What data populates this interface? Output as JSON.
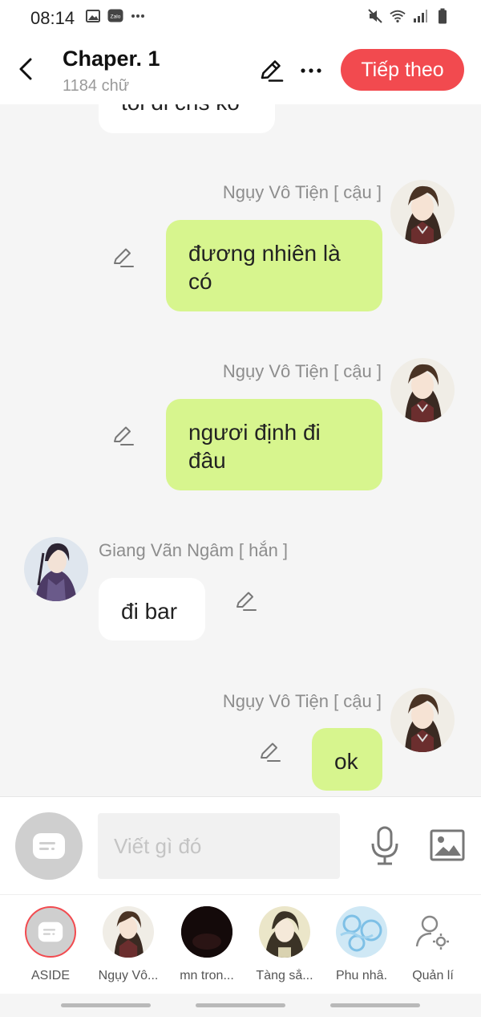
{
  "status_bar": {
    "time": "08:14",
    "left_icons": [
      "gallery-icon",
      "zalo-icon",
      "more-dots-icon"
    ],
    "right_icons": [
      "mute-icon",
      "wifi-icon",
      "signal-icon",
      "battery-icon"
    ],
    "zalo_label": "Zalo"
  },
  "header": {
    "title": "Chaper. 1",
    "word_count": "1184 chữ",
    "next_label": "Tiếp theo",
    "accent_color": "#f24a4f"
  },
  "messages": [
    {
      "speaker": "",
      "text": "tôi đi chs ko",
      "side": "left",
      "partial": true
    },
    {
      "speaker": "Ngụy Vô Tiện [ cậu ]",
      "text": "đương nhiên là có",
      "side": "right"
    },
    {
      "speaker": "Ngụy Vô Tiện [ cậu ]",
      "text": "ngươi định đi đâu",
      "side": "right"
    },
    {
      "speaker": "Giang Vãn Ngâm [ hắn ]",
      "text": "đi bar",
      "side": "left"
    },
    {
      "speaker": "Ngụy Vô Tiện [ cậu ]",
      "text": "ok",
      "side": "right"
    }
  ],
  "input": {
    "placeholder": "Viết gì đó"
  },
  "characters": [
    {
      "label": "ASIDE",
      "selected": true
    },
    {
      "label": "Ngụy Vô..."
    },
    {
      "label": "mn tron..."
    },
    {
      "label": "Tàng sắ..."
    },
    {
      "label": "Phu nhâ."
    },
    {
      "label": "Quản lí"
    }
  ],
  "colors": {
    "right_bubble": "#d7f58e",
    "left_bubble": "#ffffff",
    "chat_bg": "#f5f5f5"
  }
}
